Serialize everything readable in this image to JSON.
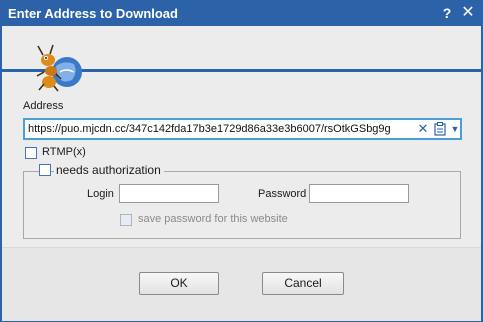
{
  "window": {
    "title": "Enter Address to Download",
    "help_label": "?",
    "close_label": "✕"
  },
  "address": {
    "label": "Address",
    "value": "https://puo.mjcdn.cc/347c142fda17b3e1729d86a33e3b6007/rsOtkGSbg9g",
    "clear_label": "✕",
    "dropdown_label": "▼"
  },
  "options": {
    "rtmp_label": "RTMP(x)",
    "rtmp_checked": false
  },
  "auth": {
    "group_label": "needs authorization",
    "checked": false,
    "login_label": "Login",
    "login_value": "",
    "password_label": "Password",
    "password_value": "",
    "save_password_label": "save password for this website",
    "save_password_checked": false
  },
  "buttons": {
    "ok": "OK",
    "cancel": "Cancel"
  },
  "colors": {
    "titlebar": "#2b62a8",
    "accent_border": "#4a9fd8"
  }
}
